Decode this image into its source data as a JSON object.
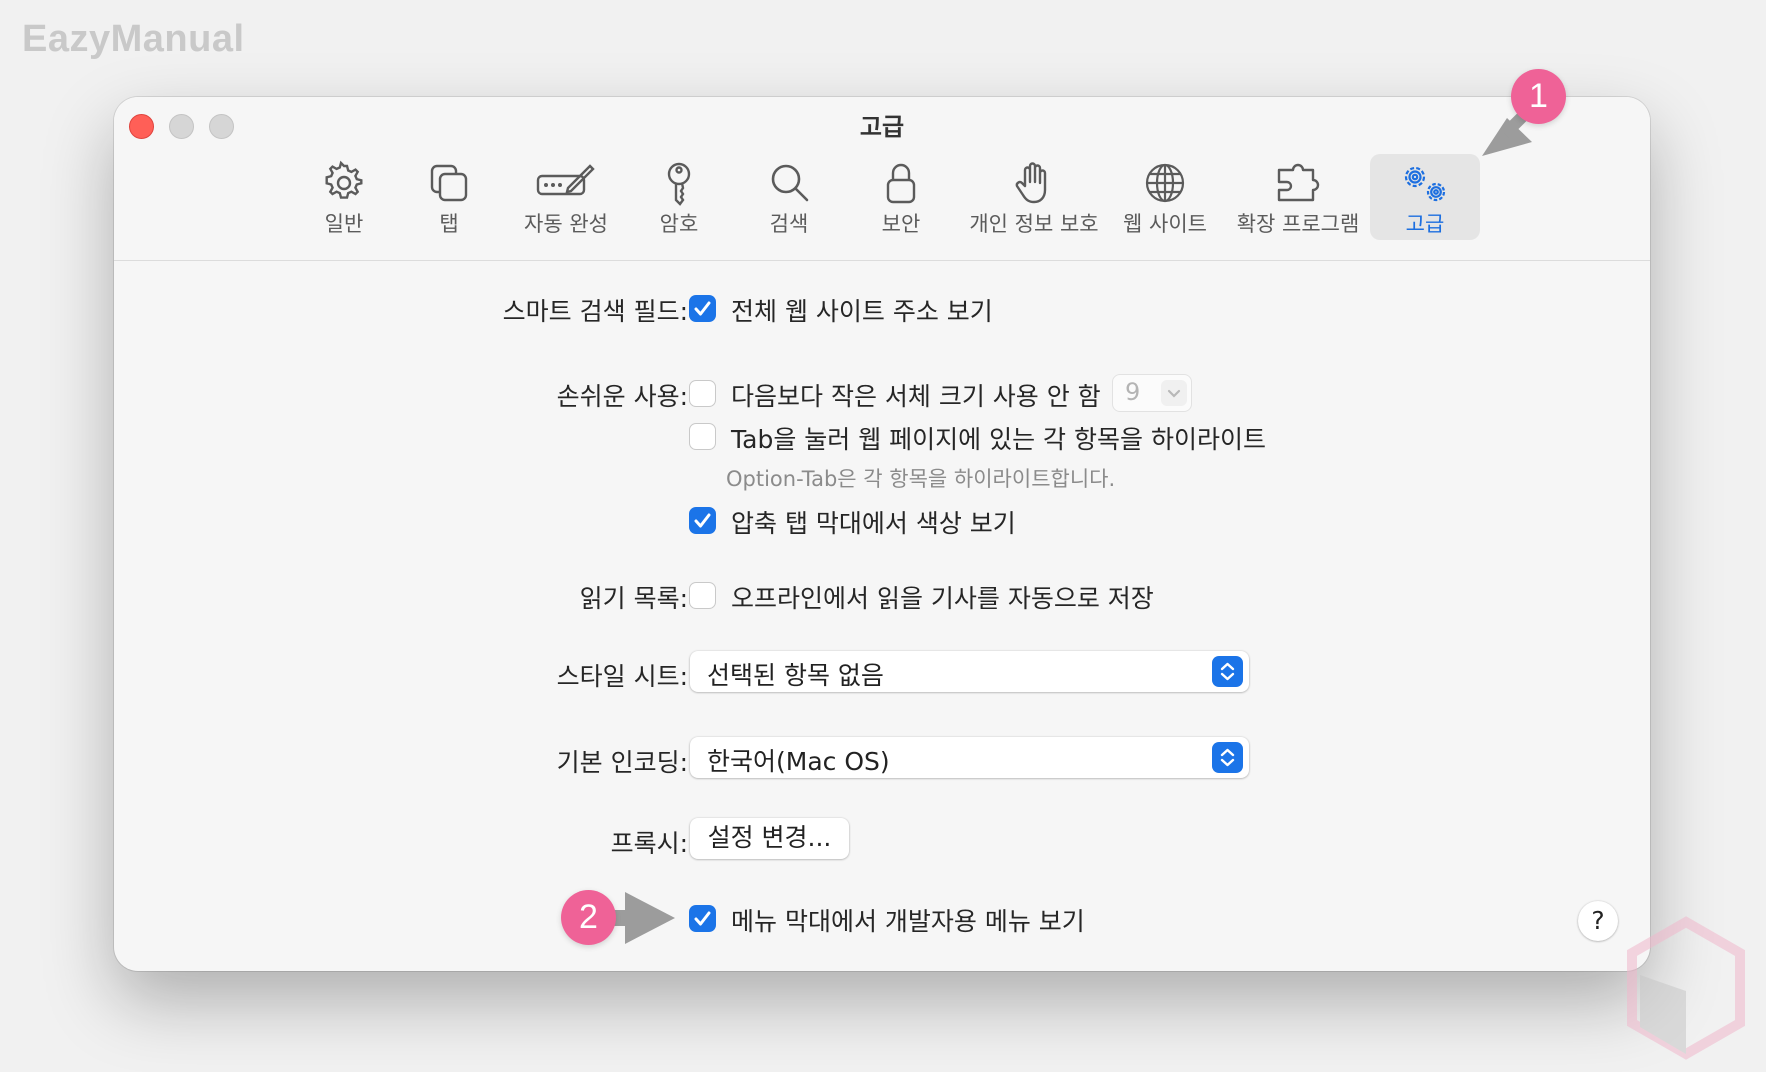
{
  "brand": "EazyManual",
  "window": {
    "title": "고급"
  },
  "tabs": [
    {
      "label": "일반",
      "icon": "gear-icon"
    },
    {
      "label": "탭",
      "icon": "tabs-icon"
    },
    {
      "label": "자동 완성",
      "icon": "pencil-form-icon"
    },
    {
      "label": "암호",
      "icon": "key-icon"
    },
    {
      "label": "검색",
      "icon": "magnifier-icon"
    },
    {
      "label": "보안",
      "icon": "lock-icon"
    },
    {
      "label": "개인 정보 보호",
      "icon": "hand-icon"
    },
    {
      "label": "웹 사이트",
      "icon": "globe-icon"
    },
    {
      "label": "확장 프로그램",
      "icon": "puzzle-icon"
    },
    {
      "label": "고급",
      "icon": "gears-icon",
      "active": true
    }
  ],
  "settings": {
    "smart_search": {
      "label": "스마트 검색 필드:",
      "option": "전체 웹 사이트 주소 보기",
      "checked": true
    },
    "accessibility": {
      "label": "손쉬운 사용:",
      "font_option": "다음보다 작은 서체 크기 사용 안 함",
      "font_checked": false,
      "font_size": "9",
      "tab_option": "Tab을 눌러 웹 페이지에 있는 각 항목을 하이라이트",
      "tab_checked": false,
      "tab_hint": "Option-Tab은 각 항목을 하이라이트합니다.",
      "color_option": "압축 탭 막대에서 색상 보기",
      "color_checked": true
    },
    "reading_list": {
      "label": "읽기 목록:",
      "option": "오프라인에서 읽을 기사를 자동으로 저장",
      "checked": false
    },
    "stylesheet": {
      "label": "스타일 시트:",
      "value": "선택된 항목 없음"
    },
    "encoding": {
      "label": "기본 인코딩:",
      "value": "한국어(Mac OS)"
    },
    "proxy": {
      "label": "프록시:",
      "button": "설정 변경..."
    },
    "develop_menu": {
      "option": "메뉴 막대에서 개발자용 메뉴 보기",
      "checked": true
    },
    "help": "?"
  },
  "annotations": {
    "badge1": "1",
    "badge2": "2"
  },
  "colors": {
    "accent": "#1b74e8",
    "badge": "#ef6297",
    "close": "#ff5f57"
  }
}
